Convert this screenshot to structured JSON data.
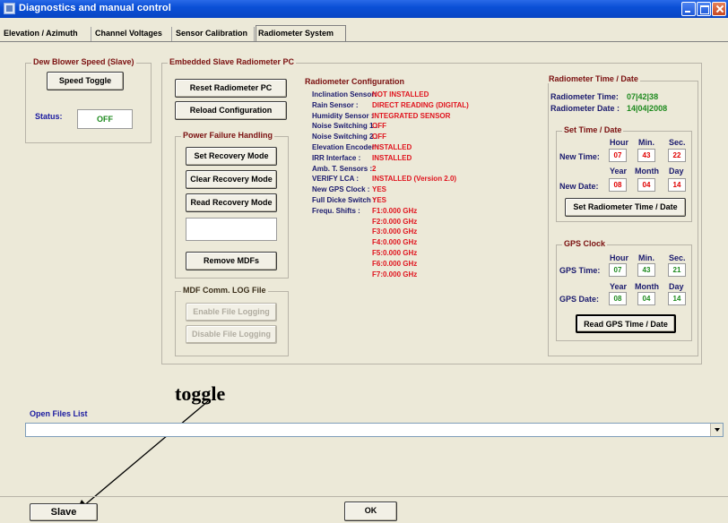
{
  "window": {
    "title": "Diagnostics and manual control"
  },
  "tabs": [
    {
      "label": "Elevation / Azimuth"
    },
    {
      "label": "Channel Voltages"
    },
    {
      "label": "Sensor Calibration"
    },
    {
      "label": "Radiometer System"
    }
  ],
  "dew_blower": {
    "title": "Dew Blower Speed (Slave)",
    "button": "Speed Toggle",
    "status_label": "Status:",
    "status_value": "OFF"
  },
  "embedded_pc": {
    "title": "Embedded Slave Radiometer PC",
    "reset_button": "Reset Radiometer PC",
    "reload_button": "Reload Configuration"
  },
  "power_failure": {
    "title": "Power Failure Handling",
    "set_button": "Set Recovery Mode",
    "clear_button": "Clear Recovery Mode",
    "read_button": "Read Recovery Mode",
    "remove_button": "Remove MDFs"
  },
  "mdf_log": {
    "title": "MDF Comm. LOG File",
    "enable_button": "Enable File Logging",
    "disable_button": "Disable File Logging"
  },
  "config": {
    "title": "Radiometer Configuration",
    "rows": [
      {
        "k": "Inclination Sensor:",
        "v": "NOT INSTALLED"
      },
      {
        "k": "Rain Sensor       :",
        "v": "DIRECT READING (DIGITAL)"
      },
      {
        "k": "Humidity Sensor   :",
        "v": "INTEGRATED SENSOR"
      },
      {
        "k": "Noise Switching 1 :",
        "v": "OFF"
      },
      {
        "k": "Noise Switching 2 :",
        "v": "OFF"
      },
      {
        "k": "Elevation Encoder :",
        "v": "INSTALLED"
      },
      {
        "k": "IRR Interface     :",
        "v": "INSTALLED"
      },
      {
        "k": "Amb. T. Sensors  :",
        "v": "2"
      },
      {
        "k": "VERIFY LCA        :",
        "v": "INSTALLED (Version 2.0)"
      },
      {
        "k": "New GPS Clock     :",
        "v": "YES"
      },
      {
        "k": "Full Dicke Switch :",
        "v": "YES"
      },
      {
        "k": "Frequ. Shifts     :",
        "v": "F1:0.000 GHz"
      },
      {
        "k": "",
        "v": "F2:0.000 GHz"
      },
      {
        "k": "",
        "v": "F3:0.000 GHz"
      },
      {
        "k": "",
        "v": "F4:0.000 GHz"
      },
      {
        "k": "",
        "v": "F5:0.000 GHz"
      },
      {
        "k": "",
        "v": "F6:0.000 GHz"
      },
      {
        "k": "",
        "v": "F7:0.000 GHz"
      }
    ]
  },
  "time_date": {
    "title": "Radiometer Time / Date",
    "time_label": "Radiometer Time:",
    "time_value": "07|42|38",
    "date_label": "Radiometer Date :",
    "date_value": "14|04|2008",
    "set_title": "Set Time / Date",
    "hour_h": "Hour",
    "min_h": "Min.",
    "sec_h": "Sec.",
    "year_h": "Year",
    "month_h": "Month",
    "day_h": "Day",
    "new_time_label": "New Time:",
    "new_time": [
      "07",
      "43",
      "22"
    ],
    "new_date_label": "New Date:",
    "new_date": [
      "08",
      "04",
      "14"
    ],
    "set_button": "Set Radiometer Time / Date",
    "gps_title": "GPS Clock",
    "gps_time_label": "GPS Time:",
    "gps_time": [
      "07",
      "43",
      "21"
    ],
    "gps_date_label": "GPS Date:",
    "gps_date": [
      "08",
      "04",
      "14"
    ],
    "read_gps_button": "Read GPS Time / Date"
  },
  "annotation": {
    "text": "toggle"
  },
  "open_files": {
    "label": "Open Files List",
    "value": ""
  },
  "footer": {
    "slave_button": "Slave",
    "ok_button": "OK"
  }
}
